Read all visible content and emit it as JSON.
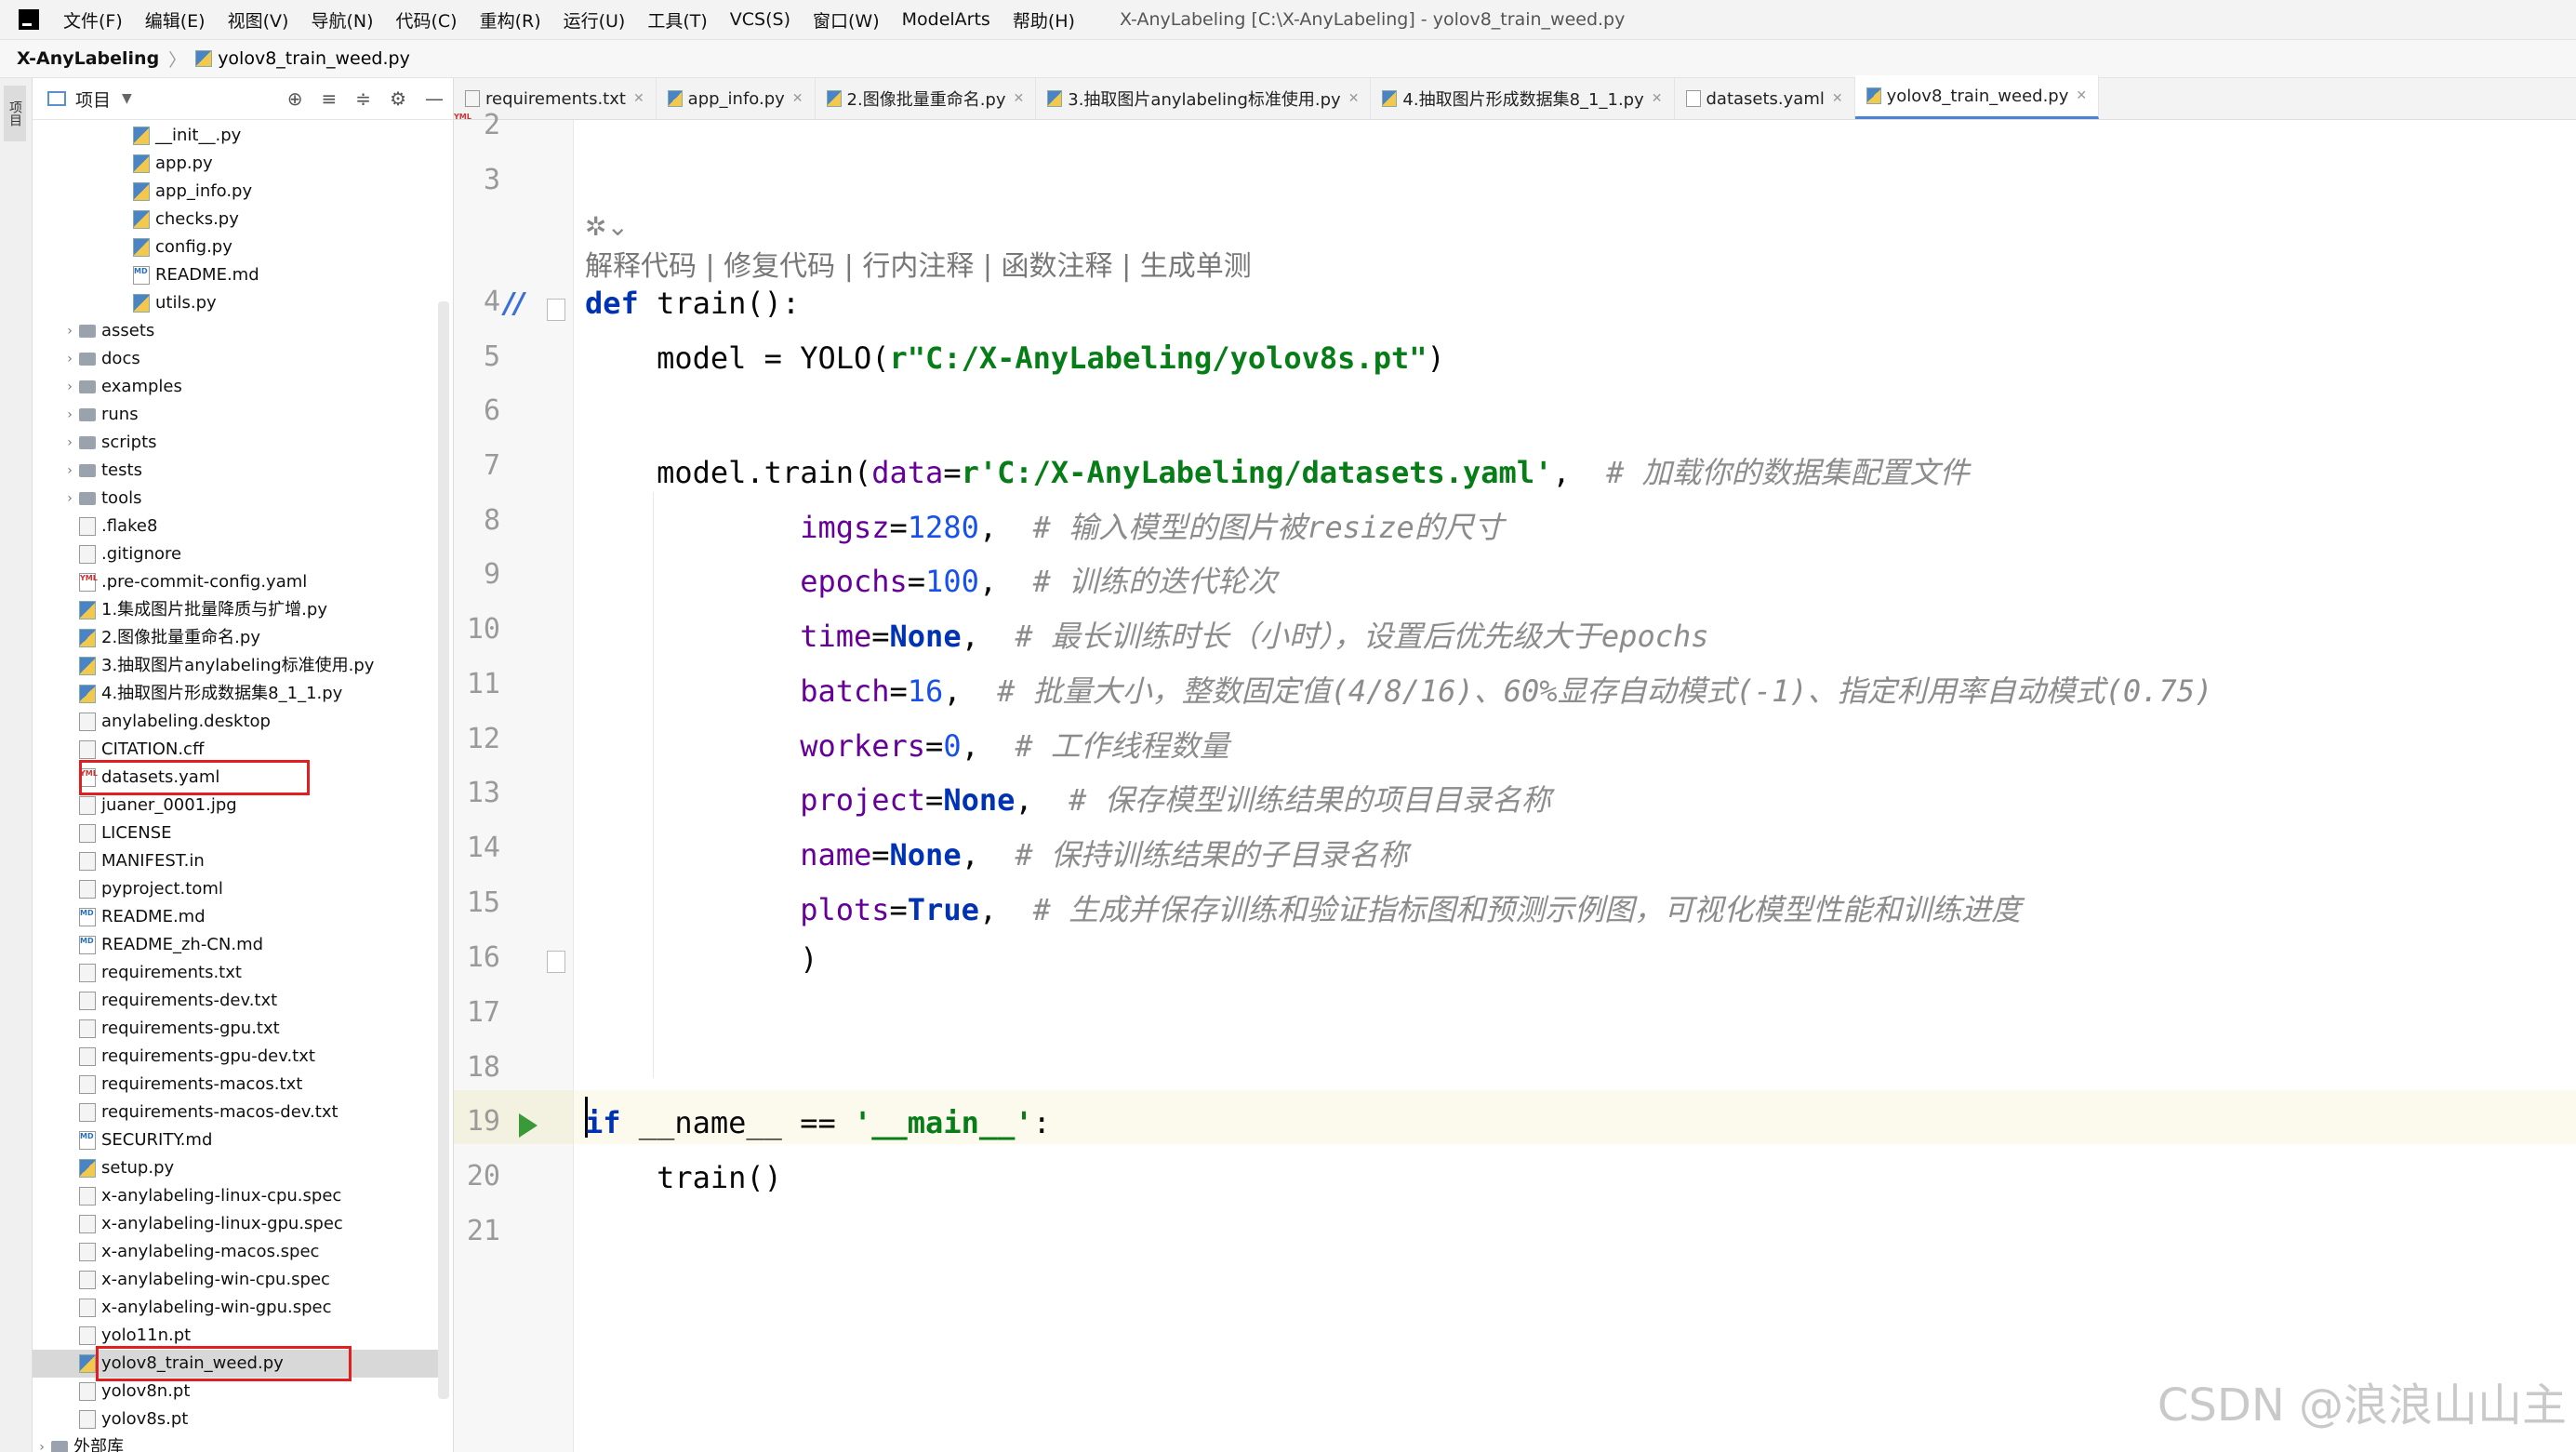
{
  "menubar": {
    "items": [
      "文件(F)",
      "编辑(E)",
      "视图(V)",
      "导航(N)",
      "代码(C)",
      "重构(R)",
      "运行(U)",
      "工具(T)",
      "VCS(S)",
      "窗口(W)",
      "ModelArts",
      "帮助(H)"
    ],
    "window_title": "X-AnyLabeling [C:\\X-AnyLabeling] - yolov8_train_weed.py"
  },
  "navbar": {
    "project": "X-AnyLabeling",
    "file": "yolov8_train_weed.py"
  },
  "left_strip": {
    "tab_label": "项目"
  },
  "project_panel": {
    "title": "项目",
    "tree": [
      {
        "label": "__init__.py",
        "type": "py",
        "indent": 2
      },
      {
        "label": "app.py",
        "type": "py",
        "indent": 2
      },
      {
        "label": "app_info.py",
        "type": "py",
        "indent": 2
      },
      {
        "label": "checks.py",
        "type": "py",
        "indent": 2
      },
      {
        "label": "config.py",
        "type": "py",
        "indent": 2
      },
      {
        "label": "README.md",
        "type": "md",
        "indent": 2
      },
      {
        "label": "utils.py",
        "type": "py",
        "indent": 2
      },
      {
        "label": "assets",
        "type": "folder",
        "indent": 1
      },
      {
        "label": "docs",
        "type": "folder",
        "indent": 1
      },
      {
        "label": "examples",
        "type": "folder",
        "indent": 1
      },
      {
        "label": "runs",
        "type": "folder",
        "indent": 1
      },
      {
        "label": "scripts",
        "type": "folder",
        "indent": 1
      },
      {
        "label": "tests",
        "type": "folder",
        "indent": 1
      },
      {
        "label": "tools",
        "type": "folder",
        "indent": 1
      },
      {
        "label": ".flake8",
        "type": "file",
        "indent": 1
      },
      {
        "label": ".gitignore",
        "type": "file",
        "indent": 1
      },
      {
        "label": ".pre-commit-config.yaml",
        "type": "yaml",
        "indent": 1
      },
      {
        "label": "1.集成图片批量降质与扩增.py",
        "type": "py",
        "indent": 1
      },
      {
        "label": "2.图像批量重命名.py",
        "type": "py",
        "indent": 1
      },
      {
        "label": "3.抽取图片anylabeling标准使用.py",
        "type": "py",
        "indent": 1
      },
      {
        "label": "4.抽取图片形成数据集8_1_1.py",
        "type": "py",
        "indent": 1
      },
      {
        "label": "anylabeling.desktop",
        "type": "file",
        "indent": 1
      },
      {
        "label": "CITATION.cff",
        "type": "file",
        "indent": 1
      },
      {
        "label": "datasets.yaml",
        "type": "yaml",
        "indent": 1
      },
      {
        "label": "juaner_0001.jpg",
        "type": "file",
        "indent": 1
      },
      {
        "label": "LICENSE",
        "type": "file",
        "indent": 1
      },
      {
        "label": "MANIFEST.in",
        "type": "file",
        "indent": 1
      },
      {
        "label": "pyproject.toml",
        "type": "file",
        "indent": 1
      },
      {
        "label": "README.md",
        "type": "md",
        "indent": 1
      },
      {
        "label": "README_zh-CN.md",
        "type": "md",
        "indent": 1
      },
      {
        "label": "requirements.txt",
        "type": "file",
        "indent": 1
      },
      {
        "label": "requirements-dev.txt",
        "type": "file",
        "indent": 1
      },
      {
        "label": "requirements-gpu.txt",
        "type": "file",
        "indent": 1
      },
      {
        "label": "requirements-gpu-dev.txt",
        "type": "file",
        "indent": 1
      },
      {
        "label": "requirements-macos.txt",
        "type": "file",
        "indent": 1
      },
      {
        "label": "requirements-macos-dev.txt",
        "type": "file",
        "indent": 1
      },
      {
        "label": "SECURITY.md",
        "type": "md",
        "indent": 1
      },
      {
        "label": "setup.py",
        "type": "py",
        "indent": 1
      },
      {
        "label": "x-anylabeling-linux-cpu.spec",
        "type": "file",
        "indent": 1
      },
      {
        "label": "x-anylabeling-linux-gpu.spec",
        "type": "file",
        "indent": 1
      },
      {
        "label": "x-anylabeling-macos.spec",
        "type": "file",
        "indent": 1
      },
      {
        "label": "x-anylabeling-win-cpu.spec",
        "type": "file",
        "indent": 1
      },
      {
        "label": "x-anylabeling-win-gpu.spec",
        "type": "file",
        "indent": 1
      },
      {
        "label": "yolo11n.pt",
        "type": "file",
        "indent": 1
      },
      {
        "label": "yolov8_train_weed.py",
        "type": "py",
        "indent": 1,
        "selected": true
      },
      {
        "label": "yolov8n.pt",
        "type": "file",
        "indent": 1
      },
      {
        "label": "yolov8s.pt",
        "type": "file",
        "indent": 1
      },
      {
        "label": "外部库",
        "type": "folder",
        "indent": 0
      }
    ]
  },
  "tabs": [
    {
      "label": "requirements.txt",
      "type": "file"
    },
    {
      "label": "app_info.py",
      "type": "py"
    },
    {
      "label": "2.图像批量重命名.py",
      "type": "py"
    },
    {
      "label": "3.抽取图片anylabeling标准使用.py",
      "type": "py"
    },
    {
      "label": "4.抽取图片形成数据集8_1_1.py",
      "type": "py"
    },
    {
      "label": "datasets.yaml",
      "type": "yaml"
    },
    {
      "label": "yolov8_train_weed.py",
      "type": "py",
      "active": true
    }
  ],
  "editor": {
    "ai_hint": "解释代码 | 修复代码 | 行内注释 | 函数注释 | 生成单测",
    "line_numbers": [
      "2",
      "3",
      "4",
      "5",
      "6",
      "7",
      "8",
      "9",
      "10",
      "11",
      "12",
      "13",
      "14",
      "15",
      "16",
      "17",
      "18",
      "19",
      "20",
      "21"
    ],
    "code": {
      "l4_kw": "def",
      "l4_rest": " train():",
      "l5_a": "    model = YOLO(",
      "l5_str": "r\"C:/X-AnyLabeling/yolov8s.pt\"",
      "l5_b": ")",
      "l7_a": "    model.train(",
      "l7_p": "data",
      "l7_eq": "=",
      "l7_str": "r'C:/X-AnyLabeling/datasets.yaml'",
      "l7_c": ",  ",
      "l7_cm": "# 加载你的数据集配置文件",
      "l8_p": "imgsz",
      "l8_v": "1280",
      "l8_cm": "# 输入模型的图片被resize的尺寸",
      "l9_p": "epochs",
      "l9_v": "100",
      "l9_cm": "# 训练的迭代轮次",
      "l10_p": "time",
      "l10_v": "None",
      "l10_cm": "# 最长训练时长（小时），设置后优先级大于epochs",
      "l11_p": "batch",
      "l11_v": "16",
      "l11_cm": "# 批量大小，整数固定值(4/8/16)、60%显存自动模式(-1)、指定利用率自动模式(0.75)",
      "l12_p": "workers",
      "l12_v": "0",
      "l12_cm": "# 工作线程数量",
      "l13_p": "project",
      "l13_v": "None",
      "l13_cm": "# 保存模型训练结果的项目目录名称",
      "l14_p": "name",
      "l14_v": "None",
      "l14_cm": "# 保持训练结果的子目录名称",
      "l15_p": "plots",
      "l15_v": "True",
      "l15_cm": "# 生成并保存训练和验证指标图和预测示例图，可视化模型性能和训练进度",
      "l16": "    )",
      "l19_kw": "if",
      "l19_a": " __name__ == ",
      "l19_str": "'__main__'",
      "l19_b": ":",
      "l20": "    train()"
    }
  },
  "watermark": "CSDN @浪浪山山主"
}
